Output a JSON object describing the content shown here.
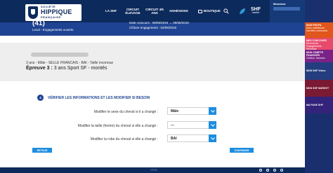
{
  "header": {
    "logo": {
      "line1": "SOCIÉTÉ",
      "line2": "HIPPIQUE",
      "line3": "FRANÇAISE"
    },
    "nav": [
      {
        "label": "LA SHF"
      },
      {
        "label": "CIRCUIT ÉLEVAGE"
      },
      {
        "label": "CIRCUIT 4/5 ANS"
      },
      {
        "label": "ADHÉSIONS"
      },
      {
        "label": "BOUTIQUE"
      }
    ],
    "market": {
      "big": "SHF",
      "small": "market"
    },
    "account": {
      "label": "Monsieur"
    }
  },
  "sidebar": {
    "items": [
      {
        "title": "MON PROFIL",
        "sub": "Infos, Adhésions, Dernière connexion"
      },
      {
        "title": "MES CONCOURS",
        "sub": "Recherche, Engagements, Résultats"
      },
      {
        "title": "MON COMPTE FINANCIER",
        "sub": "Gestion, factures"
      },
      {
        "title": "MON SHF Vision",
        "sub": ""
      },
      {
        "title": "MON SHF MARKET",
        "sub": ""
      },
      {
        "title": "MA PAGE SHF",
        "sub": ""
      }
    ]
  },
  "event": {
    "count": "(41)",
    "local": "Local - Engagements ouverts",
    "dates_line1": "Date concours : 08/06/2019 → 09/06/2019",
    "dates_line2": "Clôture engagement : 02/06/2019"
  },
  "horse": {
    "description": "3 ans - Mâle - SELLE FRANCAIS - BAI - Taille inconnue",
    "epreuve_label": "Épreuve 3 :",
    "epreuve_value": " 3 ans Sport SF - montés"
  },
  "step": {
    "number": "4",
    "title": "VÉRIFIER LES INFORMATIONS ET LES MODIFIER SI BESOIN"
  },
  "form": {
    "fields": [
      {
        "label": "Modifier le sexe du cheval si il a changé :",
        "value": "Mâle"
      },
      {
        "label": "Modifier la taille (ferrée) du cheval si elle a changé :",
        "value": "---"
      },
      {
        "label": "Modifier la robe du cheval si elle a changé :",
        "value": "BAI"
      }
    ]
  },
  "buttons": {
    "back": "RETOUR",
    "continue": "CONTINUER"
  },
  "colors": {
    "navy": "#0d2a5c",
    "blue": "#1e4392",
    "accent": "#1e8de0"
  },
  "icons": [
    "shopping-bag-icon",
    "search-icon",
    "leaf-logo-icon",
    "chevron-down-icon",
    "social-icon"
  ]
}
